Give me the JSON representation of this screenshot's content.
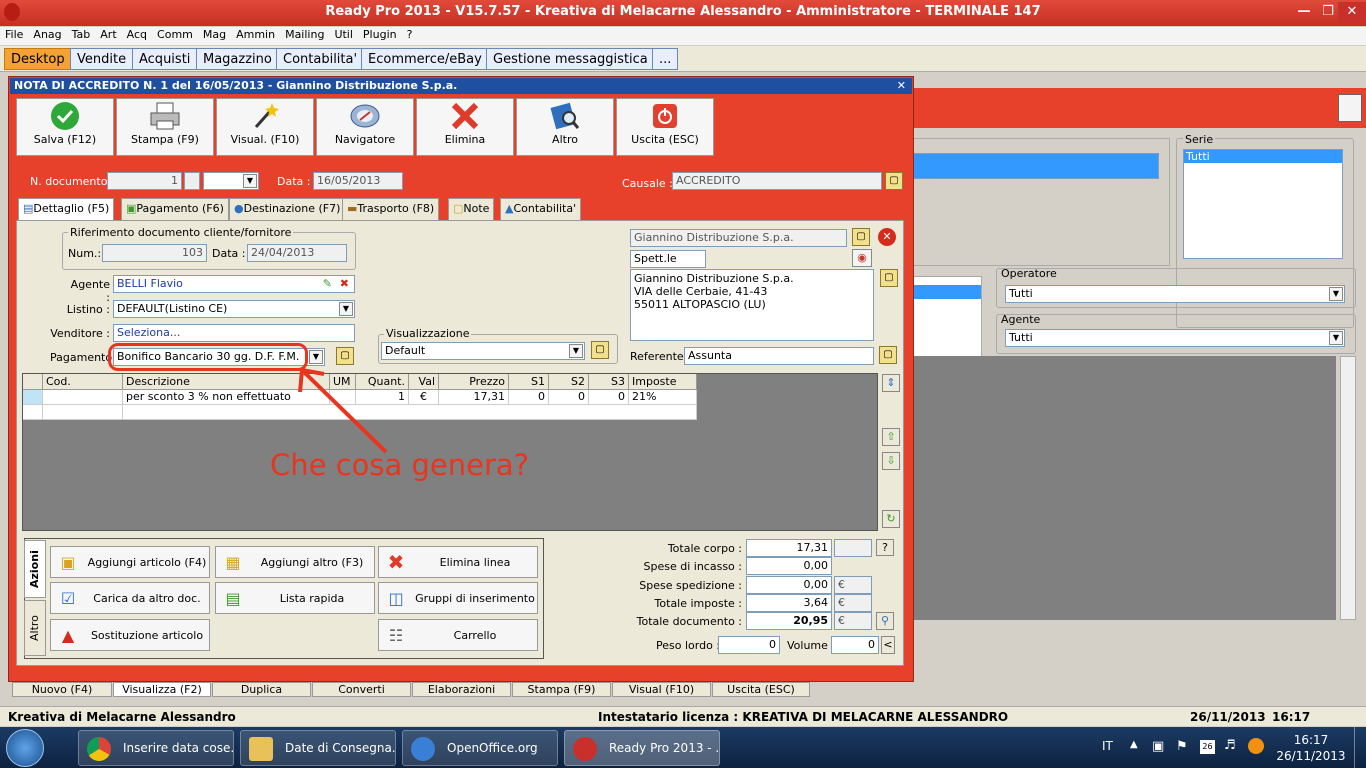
{
  "window": {
    "title": "Ready Pro 2013 - V15.7.57 - Kreativa di Melacarne Alessandro - Amministratore - TERMINALE 147"
  },
  "menu": [
    "File",
    "Anag",
    "Tab",
    "Art",
    "Acq",
    "Comm",
    "Mag",
    "Ammin",
    "Mailing",
    "Util",
    "Plugin",
    "?"
  ],
  "module_tabs": [
    "Desktop",
    "Vendite",
    "Acquisti",
    "Magazzino",
    "Contabilita'",
    "Ecommerce/eBay",
    "Gestione messaggistica",
    "..."
  ],
  "dialog": {
    "title": "NOTA DI ACCREDITO N. 1 del 16/05/2013 - Giannino Distribuzione S.p.a.",
    "toolbar": [
      {
        "label": "Salva (F12)",
        "icon": "check-icon"
      },
      {
        "label": "Stampa (F9)",
        "icon": "printer-icon"
      },
      {
        "label": "Visual. (F10)",
        "icon": "magic-wand-icon"
      },
      {
        "label": "Navigatore",
        "icon": "compass-icon"
      },
      {
        "label": "Elimina",
        "icon": "delete-x-icon"
      },
      {
        "label": "Altro",
        "icon": "book-search-icon"
      },
      {
        "label": "Uscita (ESC)",
        "icon": "exit-icon"
      }
    ],
    "doc_number_label": "N. documento :",
    "doc_number": "1",
    "date_label": "Data :",
    "date": "16/05/2013",
    "causale_label": "Causale :",
    "causale": "ACCREDITO",
    "tabs": [
      "Dettaglio (F5)",
      "Pagamento (F6)",
      "Destinazione (F7)",
      "Trasporto (F8)",
      "Note",
      "Contabilita'"
    ],
    "riferimento": {
      "title": "Riferimento documento cliente/fornitore",
      "num_label": "Num.:",
      "num": "103",
      "date_label": "Data :",
      "date": "24/04/2013"
    },
    "agente_label": "Agente :",
    "agente": "BELLI Flavio",
    "listino_label": "Listino :",
    "listino": "DEFAULT(Listino CE)",
    "venditore_label": "Venditore :",
    "venditore": "Seleziona...",
    "pagamento_label": "Pagamento",
    "pagamento": "Bonifico Bancario 30 gg. D.F. F.M.",
    "visualizzazione": {
      "title": "Visualizzazione",
      "value": "Default"
    },
    "customer": {
      "name": "Giannino Distribuzione S.p.a.",
      "greeting": "Spett.le",
      "address": [
        "Giannino Distribuzione S.p.a.",
        "VIA delle Cerbaie, 41-43",
        "55011 ALTOPASCIO (LU)"
      ],
      "referente_label": "Referente",
      "referente": "Assunta"
    },
    "grid": {
      "columns": [
        "Cod.",
        "Descrizione",
        "UM",
        "Quant.",
        "Val",
        "Prezzo",
        "S1",
        "S2",
        "S3",
        "Imposte"
      ],
      "rows": [
        [
          "",
          "per sconto 3 % non effettuato",
          "",
          "1",
          "€",
          "17,31",
          "0",
          "0",
          "0",
          "21%"
        ]
      ]
    },
    "azioni_label": "Azioni",
    "altro_label": "Altro",
    "actions": [
      {
        "label": "Aggiungi articolo (F4)",
        "icon": "box-add-icon"
      },
      {
        "label": "Aggiungi altro (F3)",
        "icon": "grid-add-icon"
      },
      {
        "label": "Elimina linea",
        "icon": "delete-x-icon"
      },
      {
        "label": "Carica da altro doc.",
        "icon": "doc-load-icon"
      },
      {
        "label": "Lista rapida",
        "icon": "list-add-icon"
      },
      {
        "label": "Gruppi di inserimento",
        "icon": "group-add-icon"
      },
      {
        "label": "Sostituzione articolo",
        "icon": "shapes-icon"
      },
      {
        "label": "Carrello",
        "icon": "cart-icon"
      }
    ],
    "totals": [
      {
        "label": "Totale corpo :",
        "value": "17,31",
        "unit": ""
      },
      {
        "label": "Spese di incasso :",
        "value": "0,00",
        "unit": ""
      },
      {
        "label": "Spese spedizione :",
        "value": "0,00",
        "unit": "€"
      },
      {
        "label": "Totale imposte :",
        "value": "3,64",
        "unit": "€"
      },
      {
        "label": "Totale documento :",
        "value": "20,95",
        "unit": "€"
      }
    ],
    "peso_label": "Peso lordo :",
    "peso": "0",
    "volume_label": "Volume :",
    "volume": "0"
  },
  "annotation": "Che cosa genera?",
  "background": {
    "serie_label": "Serie",
    "serie_value": "Tutti",
    "operatore_label": "Operatore",
    "operatore_value": "Tutti",
    "agente_label": "Agente",
    "agente_value": "Tutti"
  },
  "bottom_buttons": [
    "Nuovo (F4)",
    "Visualizza (F2)",
    "Duplica",
    "Converti",
    "Elaborazioni",
    "Stampa (F9)",
    "Visual (F10)",
    "Uscita (ESC)"
  ],
  "status": {
    "company": "Kreativa di Melacarne Alessandro",
    "license": "Intestatario licenza : KREATIVA DI MELACARNE ALESSANDRO",
    "date": "26/11/2013",
    "time": "16:17"
  },
  "taskbar": {
    "items": [
      "Inserire data cose...",
      "Date di Consegna...",
      "OpenOffice.org",
      "Ready Pro 2013 - ..."
    ],
    "lang": "IT",
    "clock_time": "16:17",
    "clock_date": "26/11/2013",
    "calendar_day": "26"
  }
}
